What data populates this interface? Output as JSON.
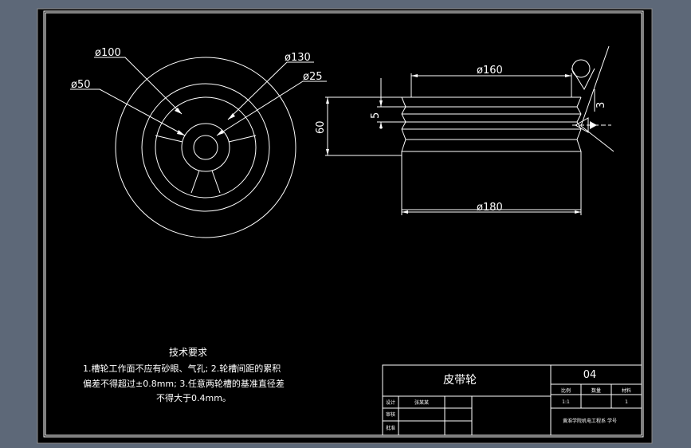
{
  "colors": {
    "viewport_bg": "#5d6878",
    "sheet_bg": "#000000",
    "lines": "#ffffff"
  },
  "front_view": {
    "dim_d100": "ø100",
    "dim_d130": "ø130",
    "dim_d50": "ø50",
    "dim_d25": "ø25"
  },
  "side_view": {
    "dim_d160": "ø160",
    "dim_d180": "ø180",
    "dim_5": "5",
    "dim_60": "60",
    "dim_3": "3"
  },
  "tech_req": {
    "title": "技术要求",
    "line1": "1.槽轮工作面不应有砂眼、气孔; 2.轮槽间距的累积",
    "line2": "偏差不得超过±0.8mm; 3.任意两轮槽的基准直径差",
    "line3": "不得大于0.4mm。"
  },
  "title_block": {
    "part_name": "皮带轮",
    "drawing_no": "04",
    "hdr_a": "比例",
    "hdr_b": "数量",
    "hdr_c": "材料",
    "row_design": "设计",
    "row_check": "审核",
    "row_approve": "批准",
    "signature": "张某某",
    "scale_val": "1:1",
    "qty_val": "1",
    "school": "黄淮学院机电工程系 学号"
  }
}
